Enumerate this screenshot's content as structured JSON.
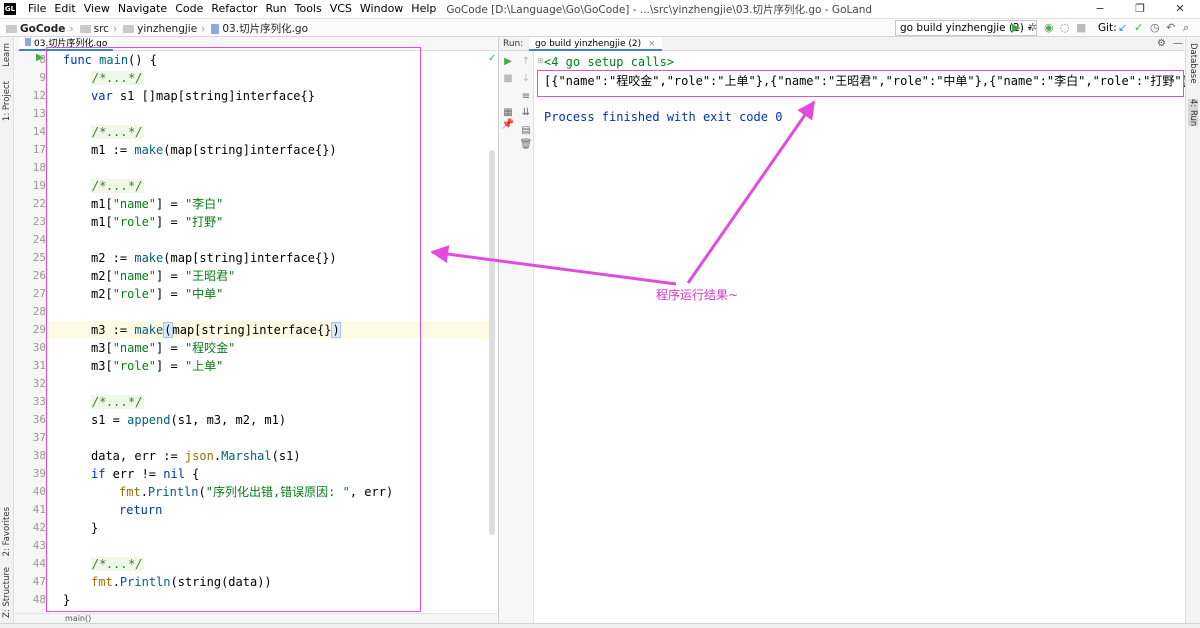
{
  "window": {
    "title": "GoCode [D:\\Language\\Go\\GoCode] - ...\\src\\yinzhengjie\\03.切片序列化.go - GoLand",
    "minimize": "−",
    "maximize": "❐",
    "close": "✕"
  },
  "menu": [
    "File",
    "Edit",
    "View",
    "Navigate",
    "Code",
    "Refactor",
    "Run",
    "Tools",
    "VCS",
    "Window",
    "Help"
  ],
  "breadcrumbs": [
    "GoCode",
    "src",
    "yinzhengjie",
    "03.切片序列化.go"
  ],
  "toolbar": {
    "run_config": "go build yinzhengjie (2)",
    "git_label": "Git:"
  },
  "editor": {
    "tab": "03.切片序列化.go",
    "line_numbers": [
      "8",
      "9",
      "12",
      "13",
      "14",
      "17",
      "18",
      "19",
      "22",
      "23",
      "24",
      "25",
      "26",
      "27",
      "28",
      "29",
      "30",
      "31",
      "32",
      "33",
      "36",
      "37",
      "38",
      "39",
      "40",
      "41",
      "42",
      "43",
      "44",
      "47",
      "48"
    ],
    "code": {
      "l8_kw": "func",
      "l8_fn": "main",
      "l8_rest": "() {",
      "l9": "/*...*/",
      "l12_kw": "var",
      "l12_rest": " s1 []map[string]interface{}",
      "l14": "/*...*/",
      "l17_a": "m1 := ",
      "l17_fn": "make",
      "l17_b": "(map[string]interface{})",
      "l19": "/*...*/",
      "l22_a": "m1[",
      "l22_k": "\"name\"",
      "l22_b": "] = ",
      "l22_v": "\"李白\"",
      "l23_a": "m1[",
      "l23_k": "\"role\"",
      "l23_b": "] = ",
      "l23_v": "\"打野\"",
      "l25_a": "m2 := ",
      "l25_fn": "make",
      "l25_b": "(map[string]interface{})",
      "l26_a": "m2[",
      "l26_k": "\"name\"",
      "l26_b": "] = ",
      "l26_v": "\"王昭君\"",
      "l27_a": "m2[",
      "l27_k": "\"role\"",
      "l27_b": "] = ",
      "l27_v": "\"中单\"",
      "l29_a": "m3 := ",
      "l29_fn": "make",
      "l29_p1": "(",
      "l29_b": "map[string]interface{}",
      "l29_p2": ")",
      "l30_a": "m3[",
      "l30_k": "\"name\"",
      "l30_b": "] = ",
      "l30_v": "\"程咬金\"",
      "l31_a": "m3[",
      "l31_k": "\"role\"",
      "l31_b": "] = ",
      "l31_v": "\"上单\"",
      "l33": "/*...*/",
      "l36_a": "s1 = ",
      "l36_fn": "append",
      "l36_b": "(s1, m3, m2, m1)",
      "l38_a": "data, err := ",
      "l38_pkg": "json",
      "l38_b": ".",
      "l38_fn": "Marshal",
      "l38_c": "(s1)",
      "l39_kw": "if",
      "l39_b": " err != ",
      "l39_kw2": "nil",
      "l39_c": " {",
      "l40_pkg": "fmt",
      "l40_b": ".",
      "l40_fn": "Println",
      "l40_c": "(",
      "l40_s": "\"序列化出错,错误原因: \"",
      "l40_d": ", err)",
      "l41_kw": "return",
      "l42": "}",
      "l44": "/*...*/",
      "l47_pkg": "fmt",
      "l47_b": ".",
      "l47_fn": "Println",
      "l47_c": "(string(data))",
      "l48": "}"
    },
    "breadcrumb_bottom": "main()"
  },
  "run": {
    "label": "Run:",
    "tab": "go build yinzhengjie (2)",
    "output": [
      "<4 go setup calls>",
      "[{\"name\":\"程咬金\",\"role\":\"上单\"},{\"name\":\"王昭君\",\"role\":\"中单\"},{\"name\":\"李白\",\"role\":\"打野\"}]",
      "Process finished with exit code 0"
    ]
  },
  "side_tools": {
    "left": [
      "1: Project",
      "Learn",
      "2: Favorites",
      "Z: Structure"
    ],
    "right": [
      "Database",
      "4: Run"
    ]
  },
  "annotation": "程序运行结果~",
  "colors": {
    "annotation": "#e24bdf",
    "keyword": "#0033b3",
    "string": "#067d17",
    "function": "#00627a",
    "comment": "#3a7a3a"
  }
}
